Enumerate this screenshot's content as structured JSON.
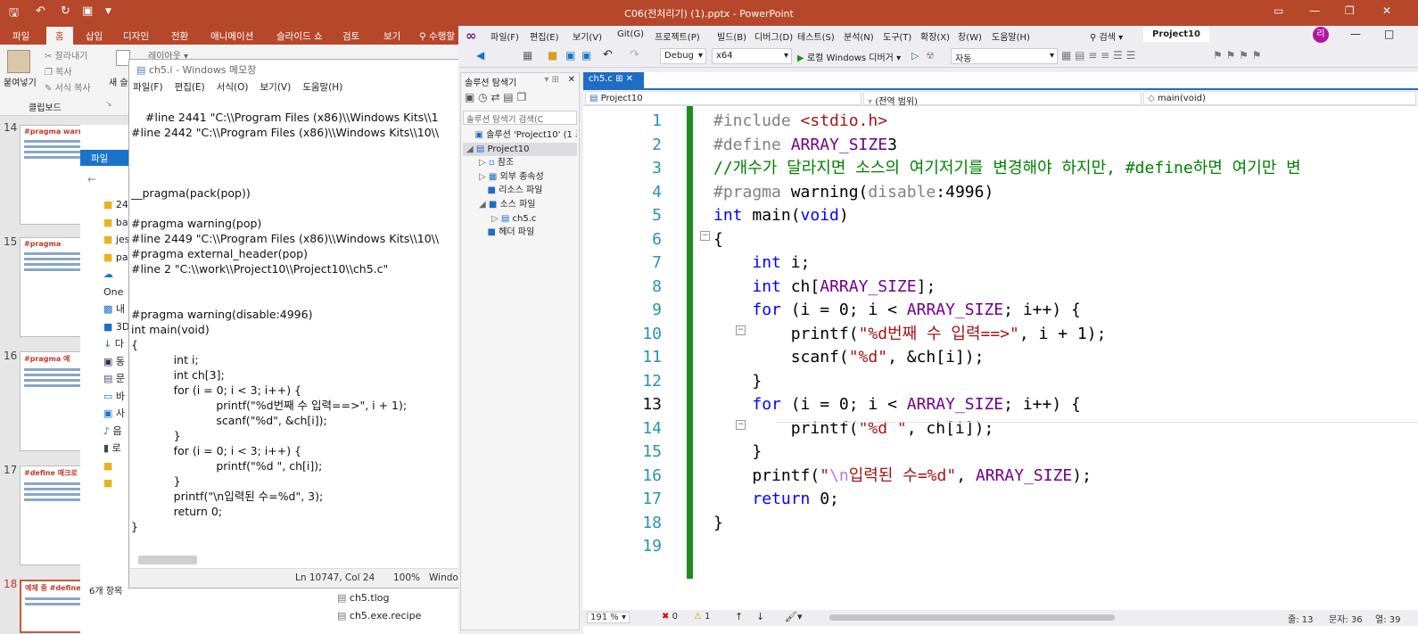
{
  "app_title": "C06(전처리기) (1).pptx - PowerPoint",
  "pp_tabs": [
    "파일",
    "홈",
    "삽입",
    "디자인",
    "전환",
    "애니메이션",
    "슬라이드 쇼",
    "검토",
    "보기",
    "수행할"
  ],
  "pp_ribbon": {
    "paste": "붙여넣기",
    "cut": "잘라내기",
    "copy": "복사",
    "format_copy": "서식 복사",
    "clipboard": "클립보드",
    "new_slide": "새 슬",
    "layout": "레이아웃"
  },
  "slides": [
    {
      "num": "14",
      "title": "#pragma warning("
    },
    {
      "num": "15",
      "title": "#pragma"
    },
    {
      "num": "16",
      "title": "#pragma 예"
    },
    {
      "num": "17",
      "title": "#define 매크로"
    },
    {
      "num": "18",
      "title": "예제 중 #define 예"
    }
  ],
  "explorer": {
    "file_tab": "파일",
    "items": [
      "24",
      "ba",
      "jes",
      "pa",
      "One",
      "내",
      "3D",
      "다",
      "동",
      "문",
      "바",
      "사",
      "음",
      "로",
      "",
      ""
    ],
    "count_label": "6개 항목",
    "files": [
      "ch5.tlog",
      "ch5.exe.recipe"
    ]
  },
  "notepad": {
    "title": "ch5.i - Windows 메모장",
    "menu": [
      "파일(F)",
      "편집(E)",
      "서식(O)",
      "보기(V)",
      "도움말(H)"
    ],
    "lines": [
      "    #line 2441 \"C:\\\\Program Files (x86)\\\\Windows Kits\\\\1",
      "#line 2442 \"C:\\\\Program Files (x86)\\\\Windows Kits\\\\10\\\\",
      "",
      "",
      "",
      "__pragma(pack(pop))",
      "",
      "#pragma warning(pop)",
      "#line 2449 \"C:\\\\Program Files (x86)\\\\Windows Kits\\\\10\\\\",
      "#pragma external_header(pop)",
      "#line 2 \"C:\\\\work\\\\Project10\\\\Project10\\\\ch5.c\"",
      "",
      "",
      "#pragma warning(disable:4996)",
      "int main(void)",
      "{",
      "            int i;",
      "            int ch[3];",
      "            for (i = 0; i < 3; i++) {",
      "                        printf(\"%d번째 수 입력==>\", i + 1);",
      "                        scanf(\"%d\", &ch[i]);",
      "            }",
      "            for (i = 0; i < 3; i++) {",
      "                        printf(\"%d \", ch[i]);",
      "            }",
      "            printf(\"\\n입력된 수=%d\", 3);",
      "            return 0;",
      "}"
    ],
    "status": {
      "position": "Ln 10747, Col 24",
      "zoom": "100%",
      "eol": "Window"
    }
  },
  "vs": {
    "menu": [
      "파일(F)",
      "편집(E)",
      "보기(V)",
      "Git(G)",
      "프로젝트(P)",
      "빌드(B)",
      "디버그(D)",
      "테스트(S)",
      "분석(N)",
      "도구(T)",
      "확장(X)",
      "창(W)",
      "도움말(H)"
    ],
    "search": "검색",
    "project_badge": "Project10",
    "user_initials": "리",
    "config": "Debug",
    "platform": "x64",
    "debugger": "로컬 Windows 디버거",
    "run_target": "자동",
    "solution": {
      "title": "솔루션 탐색기",
      "search_placeholder": "솔루션 탐색기 검색(C",
      "tree": [
        {
          "label": "솔루션 'Project10' (1 프",
          "depth": 0
        },
        {
          "label": "Project10",
          "depth": 0
        },
        {
          "label": "참조",
          "depth": 1
        },
        {
          "label": "외부 종속성",
          "depth": 1
        },
        {
          "label": "리소스 파일",
          "depth": 1
        },
        {
          "label": "소스 파일",
          "depth": 1
        },
        {
          "label": "ch5.c",
          "depth": 2
        },
        {
          "label": "헤더 파일",
          "depth": 1
        }
      ]
    },
    "editor_tab": "ch5.c",
    "nav": {
      "project": "Project10",
      "scope": "(전역 범위)",
      "member": "main(void)"
    },
    "code_lines": [
      {
        "n": "1",
        "segs": [
          [
            "pp",
            "#include "
          ],
          [
            "st",
            "<stdio.h>"
          ]
        ]
      },
      {
        "n": "2",
        "segs": [
          [
            "pp",
            "#define "
          ],
          [
            "mc",
            "ARRAY_SIZE"
          ],
          [
            "",
            "3"
          ]
        ]
      },
      {
        "n": "3",
        "segs": [
          [
            "cm",
            "//개수가 달라지면 소스의 여기저기를 변경해야 하지만, #define하면 여기만 변"
          ]
        ]
      },
      {
        "n": "4",
        "segs": [
          [
            "pp",
            "#pragma "
          ],
          [
            "",
            "warning("
          ],
          [
            "pp",
            "disable"
          ],
          [
            "",
            ":4996)"
          ]
        ]
      },
      {
        "n": "5",
        "segs": [
          [
            "kw",
            "int "
          ],
          [
            "",
            "main("
          ],
          [
            "kw",
            "void"
          ],
          [
            "",
            ")"
          ]
        ]
      },
      {
        "n": "6",
        "segs": [
          [
            "",
            "{"
          ]
        ]
      },
      {
        "n": "7",
        "segs": [
          [
            "",
            "    "
          ],
          [
            "kw",
            "int "
          ],
          [
            "",
            "i;"
          ]
        ]
      },
      {
        "n": "8",
        "segs": [
          [
            "",
            "    "
          ],
          [
            "kw",
            "int "
          ],
          [
            "",
            "ch["
          ],
          [
            "mc",
            "ARRAY_SIZE"
          ],
          [
            "",
            "];"
          ]
        ]
      },
      {
        "n": "9",
        "segs": [
          [
            "",
            "    "
          ],
          [
            "kw",
            "for "
          ],
          [
            "",
            "(i = 0; i < "
          ],
          [
            "mc",
            "ARRAY_SIZE"
          ],
          [
            "",
            "; i++) {"
          ]
        ]
      },
      {
        "n": "10",
        "segs": [
          [
            "",
            "        printf("
          ],
          [
            "st",
            "\"%d번째 수 입력==>\""
          ],
          [
            "",
            ", i + 1);"
          ]
        ]
      },
      {
        "n": "11",
        "segs": [
          [
            "",
            "        scanf("
          ],
          [
            "st",
            "\"%d\""
          ],
          [
            "",
            ", &ch[i]);"
          ]
        ]
      },
      {
        "n": "12",
        "segs": [
          [
            "",
            "    }"
          ]
        ]
      },
      {
        "n": "13",
        "segs": [
          [
            "",
            "    "
          ],
          [
            "kw",
            "for "
          ],
          [
            "",
            "(i = 0; i < "
          ],
          [
            "mc",
            "ARRAY_SIZE"
          ],
          [
            "",
            "; i++) {"
          ]
        ]
      },
      {
        "n": "14",
        "segs": [
          [
            "",
            "        printf("
          ],
          [
            "st",
            "\"%d \""
          ],
          [
            "",
            ", ch[i]);"
          ]
        ]
      },
      {
        "n": "15",
        "segs": [
          [
            "",
            "    }"
          ]
        ]
      },
      {
        "n": "16",
        "segs": [
          [
            "",
            "    printf("
          ],
          [
            "st",
            "\""
          ],
          [
            "es",
            "\\n"
          ],
          [
            "st",
            "입력된 수=%d\""
          ],
          [
            "",
            ", "
          ],
          [
            "mc",
            "ARRAY_SIZE"
          ],
          [
            "",
            ");"
          ]
        ]
      },
      {
        "n": "17",
        "segs": [
          [
            "",
            "    "
          ],
          [
            "kw",
            "return "
          ],
          [
            "",
            "0;"
          ]
        ]
      },
      {
        "n": "18",
        "segs": [
          [
            "",
            "}"
          ]
        ]
      },
      {
        "n": "19",
        "segs": []
      }
    ],
    "status": {
      "zoom": "191 %",
      "errors": "0",
      "warnings": "1",
      "line": "줄: 13",
      "char": "문자: 36",
      "col": "열: 39"
    }
  },
  "colors": {
    "ppt_red": "#b7472a",
    "vs_bg": "#eeeef2",
    "keyword": "#0000ff",
    "string": "#a31515",
    "macro": "#6f008a",
    "comment": "#008000",
    "gutter_green": "#1e8c1e"
  }
}
